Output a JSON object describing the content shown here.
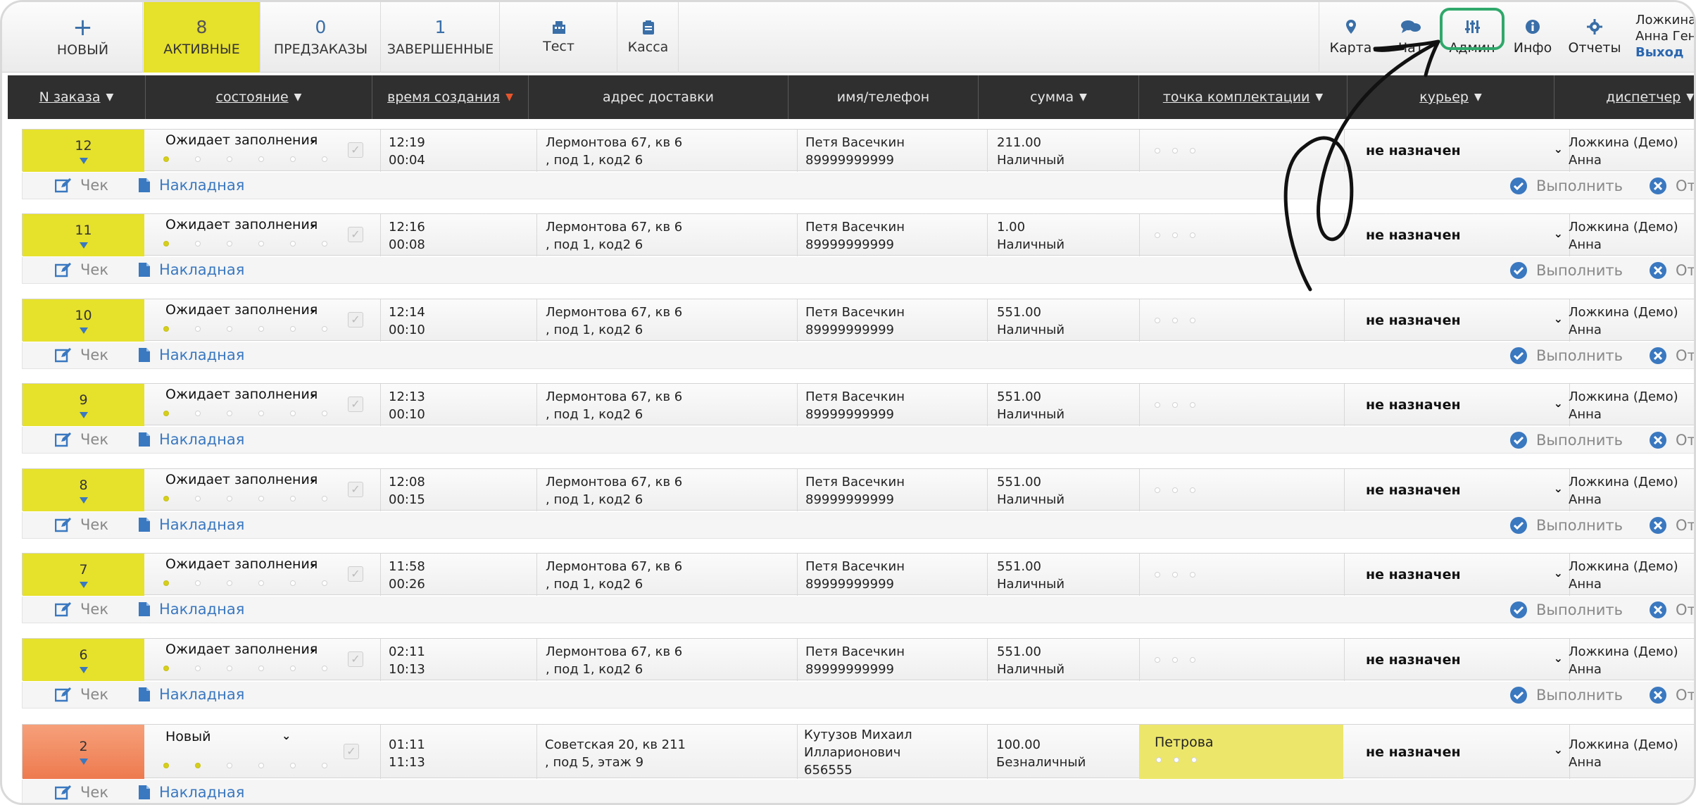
{
  "topbar": {
    "new": {
      "symbol": "+",
      "label": "НОВЫЙ"
    },
    "tabs": [
      {
        "count": "8",
        "label": "АКТИВНЫЕ"
      },
      {
        "count": "0",
        "label": "ПРЕДЗАКАЗЫ"
      },
      {
        "count": "1",
        "label": "ЗАВЕРШЕННЫЕ"
      }
    ],
    "test_label": "Тест",
    "kassa_label": "Касса",
    "right": {
      "map": "Карта",
      "chat": "Чат",
      "admin": "Админ",
      "info": "Инфо",
      "reports": "Отчеты"
    },
    "user_line1": "Ложкина",
    "user_line2": "Анна Гени",
    "logout": "Выход"
  },
  "columns": {
    "num": "N заказа",
    "state": "состояние",
    "created": "время создания",
    "address": "адрес доставки",
    "name": "имя/телефон",
    "sum": "сумма",
    "point": "точка комплектации",
    "courier": "курьер",
    "dispatcher": "диспетчер"
  },
  "colors": {
    "active_yellow": "#e6e12b",
    "header_bg": "#2f2f2f",
    "link_blue": "#3a78c0",
    "sort_arrow_red": "#e7552c",
    "new_order_orange": "#ee7a4f"
  },
  "actions": {
    "check": "Чек",
    "invoice": "Накладная",
    "complete": "Выполнить",
    "cancel": "Отм"
  },
  "orders": [
    {
      "num": "12",
      "state": "Ожидает заполнения",
      "time": "12:19",
      "elapsed": "00:04",
      "addr1": "Лермонтова 67, кв 6",
      "addr2": ", под 1, код2 6",
      "name": "Петя Васечкин",
      "phone": "89999999999",
      "sum": "211.00",
      "pay": "Наличный",
      "courier": "не назначен",
      "disp1": "Ложкина (Демо)",
      "disp2": "Анна",
      "progress": "1 of 6"
    },
    {
      "num": "11",
      "state": "Ожидает заполнения",
      "time": "12:16",
      "elapsed": "00:08",
      "addr1": "Лермонтова 67, кв 6",
      "addr2": ", под 1, код2 6",
      "name": "Петя Васечкин",
      "phone": "89999999999",
      "sum": "1.00",
      "pay": "Наличный",
      "courier": "не назначен",
      "disp1": "Ложкина (Демо)",
      "disp2": "Анна",
      "progress": "1 of 6"
    },
    {
      "num": "10",
      "state": "Ожидает заполнения",
      "time": "12:14",
      "elapsed": "00:10",
      "addr1": "Лермонтова 67, кв 6",
      "addr2": ", под 1, код2 6",
      "name": "Петя Васечкин",
      "phone": "89999999999",
      "sum": "551.00",
      "pay": "Наличный",
      "courier": "не назначен",
      "disp1": "Ложкина (Демо)",
      "disp2": "Анна",
      "progress": "1 of 6"
    },
    {
      "num": "9",
      "state": "Ожидает заполнения",
      "time": "12:13",
      "elapsed": "00:10",
      "addr1": "Лермонтова 67, кв 6",
      "addr2": ", под 1, код2 6",
      "name": "Петя Васечкин",
      "phone": "89999999999",
      "sum": "551.00",
      "pay": "Наличный",
      "courier": "не назначен",
      "disp1": "Ложкина (Демо)",
      "disp2": "Анна",
      "progress": "1 of 6"
    },
    {
      "num": "8",
      "state": "Ожидает заполнения",
      "time": "12:08",
      "elapsed": "00:15",
      "addr1": "Лермонтова 67, кв 6",
      "addr2": ", под 1, код2 6",
      "name": "Петя Васечкин",
      "phone": "89999999999",
      "sum": "551.00",
      "pay": "Наличный",
      "courier": "не назначен",
      "disp1": "Ложкина (Демо)",
      "disp2": "Анна",
      "progress": "1 of 6"
    },
    {
      "num": "7",
      "state": "Ожидает заполнения",
      "time": "11:58",
      "elapsed": "00:26",
      "addr1": "Лермонтова 67, кв 6",
      "addr2": ", под 1, код2 6",
      "name": "Петя Васечкин",
      "phone": "89999999999",
      "sum": "551.00",
      "pay": "Наличный",
      "courier": "не назначен",
      "disp1": "Ложкина (Демо)",
      "disp2": "Анна",
      "progress": "1 of 6"
    },
    {
      "num": "6",
      "state": "Ожидает заполнения",
      "time": "02:11",
      "elapsed": "10:13",
      "addr1": "Лермонтова 67, кв 6",
      "addr2": ", под 1, код2 6",
      "name": "Петя Васечкин",
      "phone": "89999999999",
      "sum": "551.00",
      "pay": "Наличный",
      "courier": "не назначен",
      "disp1": "Ложкина (Демо)",
      "disp2": "Анна",
      "progress": "1 of 6"
    }
  ],
  "last_order": {
    "num": "2",
    "state": "Новый",
    "time": "01:11",
    "elapsed": "11:13",
    "addr1": "Советская 20, кв 211",
    "addr2": ", под 5, этаж 9",
    "name1": "Кутузов Михаил",
    "name2": "Илларионович",
    "phone": "656555",
    "sum": "100.00",
    "pay": "Безналичный",
    "point": "Петрова",
    "courier": "не назначен",
    "disp1": "Ложкина (Демо)",
    "disp2": "Анна",
    "progress": "2 of 6"
  }
}
